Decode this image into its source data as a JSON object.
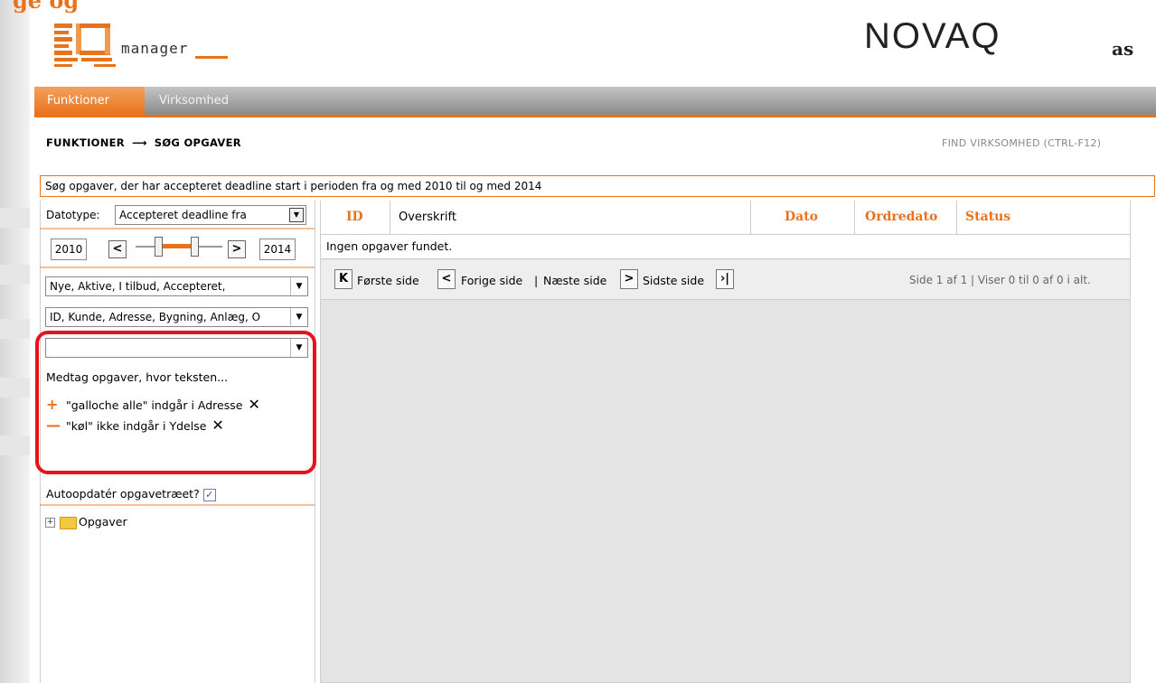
{
  "top_fragment": "ge og",
  "logo": {
    "text": "manager"
  },
  "brand": {
    "name": "NOVAQ",
    "suffix": "as"
  },
  "menu": {
    "tabs": [
      "Funktioner",
      "Virksomhed"
    ]
  },
  "breadcrumb": {
    "root": "FUNKTIONER",
    "arrow": "⟶",
    "current": "SØG OPGAVER"
  },
  "find_link": "FIND VIRKSOMHED (CTRL-F12)",
  "info_text": "Søg opgaver, der har accepteret deadline start i perioden fra og med 2010 til og med 2014",
  "filters": {
    "datatype_label": "Datotype:",
    "datatype_value": "Accepteret deadline fra",
    "year_from": "2010",
    "year_to": "2014",
    "prev_glyph": "<",
    "next_glyph": ">",
    "status_select": "Nye, Aktive, I tilbud, Accepteret,",
    "fields_select": "ID, Kunde, Adresse, Bygning, Anlæg, O",
    "text_select": "",
    "include_label": "Medtag opgaver, hvor teksten...",
    "rules": [
      {
        "sign": "+",
        "text": "\"galloche alle\" indgår i Adresse"
      },
      {
        "sign": "—",
        "text": "\"køl\" ikke indgår i Ydelse"
      }
    ],
    "remove_glyph": "✕",
    "auto_update_label": "Autoopdatér opgavetræet?",
    "auto_update_checked": true,
    "check_glyph": "✓"
  },
  "tree": {
    "expander": "+",
    "root_label": "Opgaver"
  },
  "grid": {
    "columns": [
      "ID",
      "Overskrift",
      "Dato",
      "Ordredato",
      "Status"
    ],
    "empty_text": "Ingen opgaver fundet.",
    "pager": {
      "first_glyph": "K",
      "prev_glyph": "<",
      "next_glyph": ">",
      "last_glyph": "›|",
      "first": "Første side",
      "prev": "Forige side",
      "separator": "|",
      "next": "Næste side",
      "last": "Sidste side",
      "info": "Side 1 af 1 | Viser 0 til 0 af 0 i alt."
    }
  },
  "colors": {
    "accent": "#e8731d",
    "highlight": "#e8131a",
    "menubar": "#9a9a9a"
  }
}
